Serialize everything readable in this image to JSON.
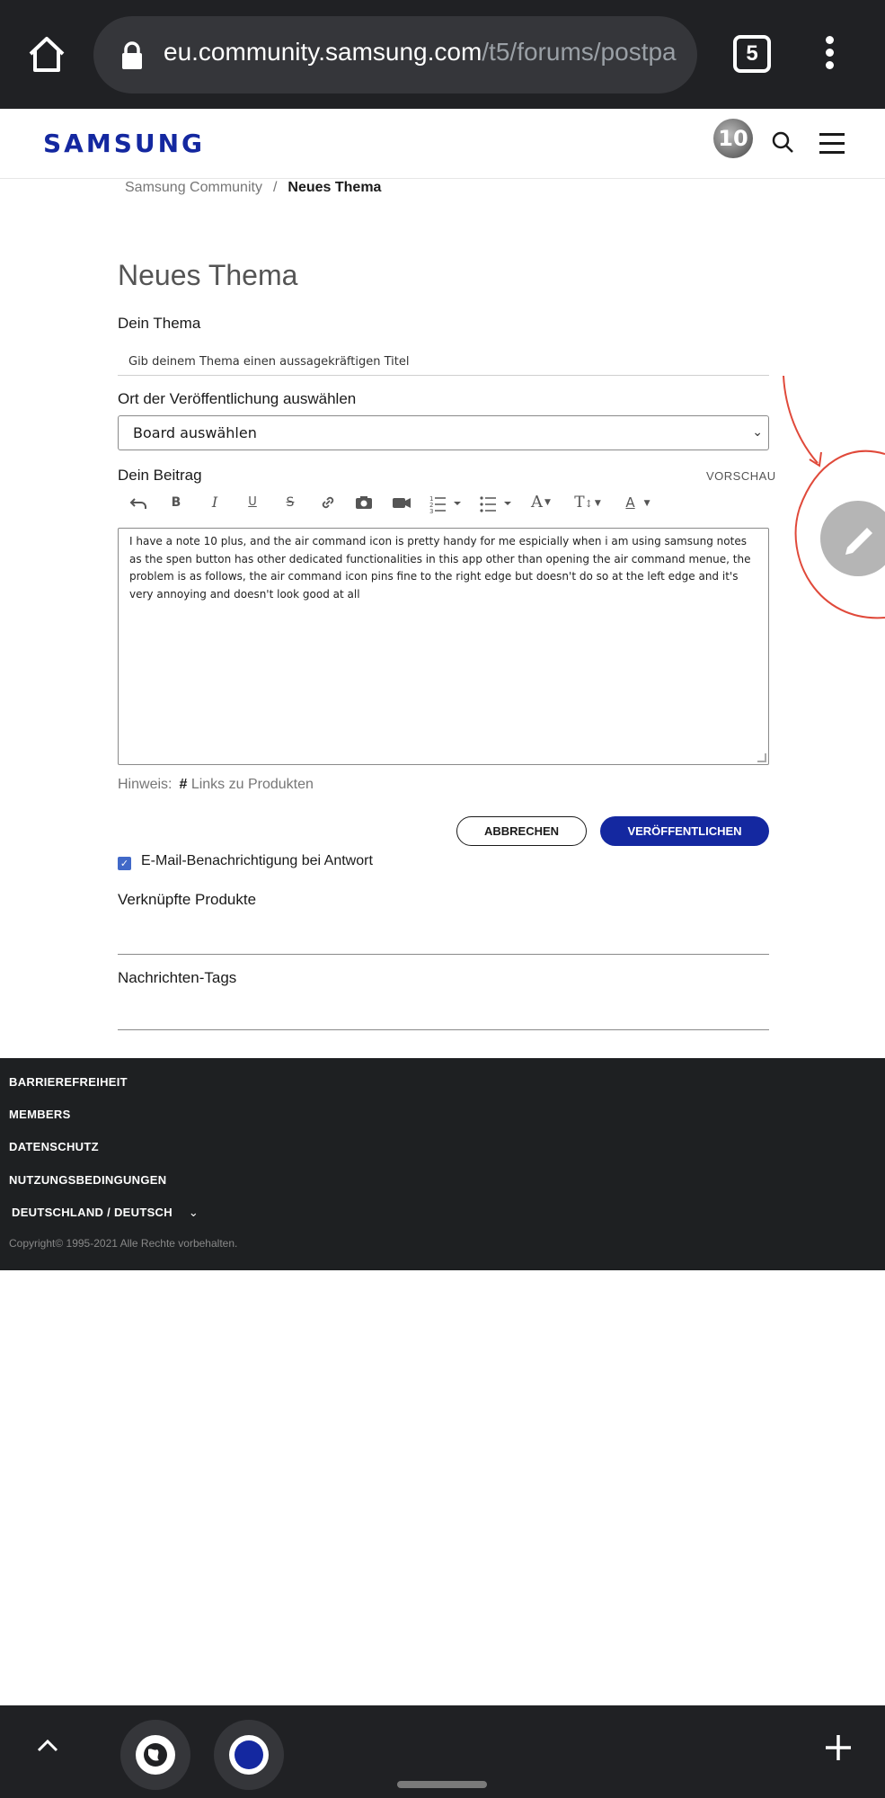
{
  "browser": {
    "url_host": "eu.community.samsung.com",
    "url_path": "/t5/forums/postpa",
    "tab_count": "5"
  },
  "header": {
    "logo": "SAMSUNG",
    "avatar_text": "10"
  },
  "breadcrumb": {
    "home": "Samsung Community",
    "separator": "/",
    "current": "Neues Thema"
  },
  "form": {
    "page_title": "Neues Thema",
    "topic_label": "Dein Thema",
    "topic_placeholder": "Gib deinem Thema einen aussagekräftigen Titel",
    "location_label": "Ort der Veröffentlichung auswählen",
    "board_selected": "Board auswählen",
    "post_label": "Dein Beitrag",
    "preview_label": "VORSCHAU",
    "body_text": "I have a note 10 plus, and the air command icon is pretty handy for me espicially when i am using samsung notes as the spen button has other dedicated functionalities  in this app other than opening the air command menue, the problem is as follows, the air command icon pins fine to the right edge but doesn't  do so at the left edge and it's very annoying and doesn't look good at all",
    "hint_label": "Hinweis:",
    "hint_hash": "#",
    "hint_link": "Links zu Produkten",
    "cancel_label": "ABBRECHEN",
    "publish_label": "VERÖFFENTLICHEN",
    "email_notify_label": "E-Mail-Benachrichtigung bei Antwort",
    "email_notify_checked": true,
    "linked_products_label": "Verknüpfte Produkte",
    "tags_label": "Nachrichten-Tags"
  },
  "toolbar": {
    "italic": "I",
    "bold": "B",
    "underline": "U",
    "strike": "S",
    "font": "A",
    "size": "T",
    "color": "A"
  },
  "footer": {
    "links": [
      "BARRIEREFREIHEIT",
      "MEMBERS",
      "DATENSCHUTZ",
      "NUTZUNGSBEDINGUNGEN"
    ],
    "region": "DEUTSCHLAND / DEUTSCH",
    "copyright": "Copyright© 1995-2021 Alle Rechte vorbehalten."
  },
  "colors": {
    "brand": "#1428a0",
    "annotation": "#e0493a",
    "browser_chrome": "#202124",
    "footer_bg": "#1e2022"
  }
}
